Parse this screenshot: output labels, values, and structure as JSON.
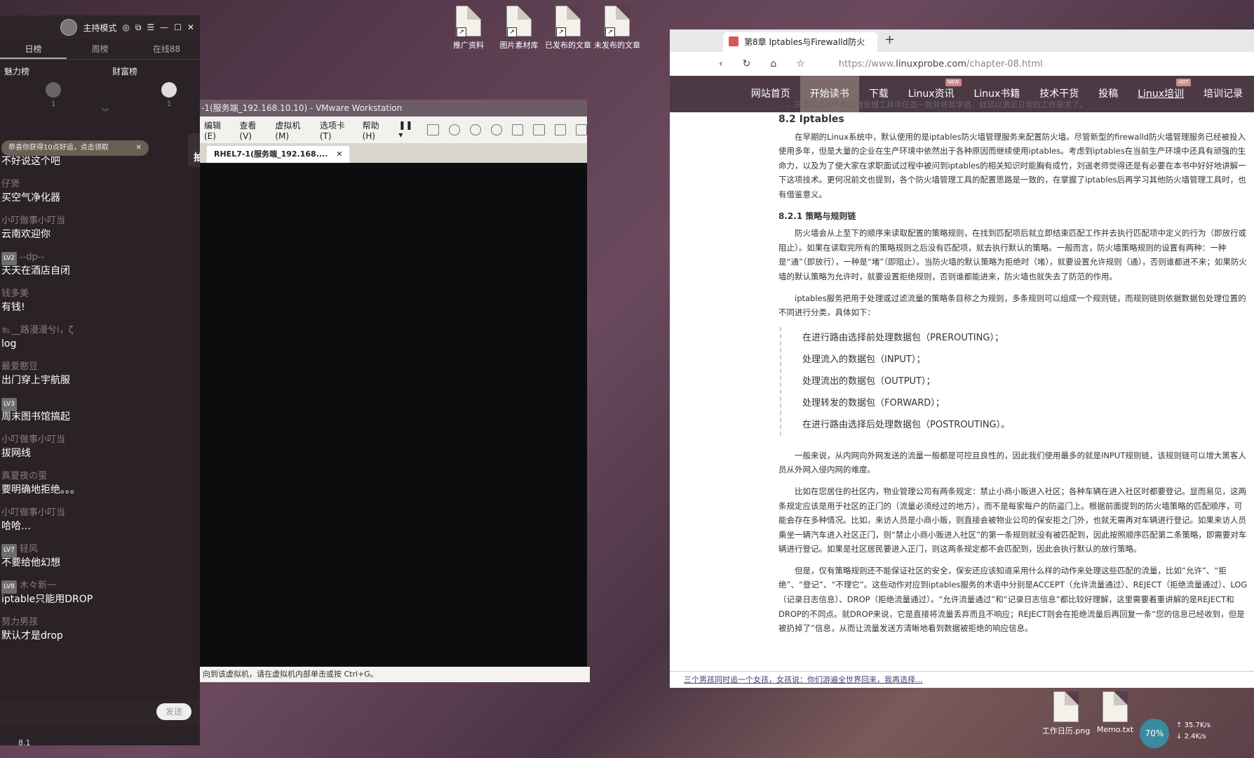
{
  "desktop": {
    "icons_top": [
      {
        "label": "推广资料"
      },
      {
        "label": "图片素材库"
      },
      {
        "label": "已发布的文章"
      },
      {
        "label": "未发布的文章"
      }
    ],
    "icons_bottom": [
      {
        "label": "工作日历.png"
      },
      {
        "label": "Memo.txt"
      }
    ],
    "clock": "8.1"
  },
  "live_panel": {
    "host_mode": "主持模式",
    "tabs": [
      "日榜",
      "周榜",
      "在线88"
    ],
    "rank_left": "魅力榜",
    "rank_right": "财富榜",
    "rank_left_count": "1",
    "rank_right_count": "1",
    "notice": "恭喜你获得10点好运，点击领取",
    "lottery": "抽奖",
    "messages": [
      {
        "user": "",
        "text": "不好说这个吧"
      },
      {
        "user": "仔煲",
        "text": "买空气净化器"
      },
      {
        "user": "小叮做事小叮当",
        "text": "云南欢迎你"
      },
      {
        "user": "--dp--",
        "level": "LV2",
        "text": "天天在酒店自闭"
      },
      {
        "user": "钱多美",
        "text": "有钱!"
      },
      {
        "user": "℡__路漫漫兮i，ζ",
        "text": "log"
      },
      {
        "user": "最爱憨豆",
        "text": "出门穿上宇航服"
      },
      {
        "user": "",
        "level": "LV3",
        "text": "周末图书馆搞起"
      },
      {
        "user": "小叮做事小叮当",
        "text": "拔网线"
      },
      {
        "user": "真夏夜の萤",
        "text": "要明确地拒绝。。。"
      },
      {
        "user": "小叮做事小叮当",
        "text": "哈哈…"
      },
      {
        "user": "轻风",
        "level": "LV7",
        "text": "不要给他幻想"
      },
      {
        "user": "木々新一",
        "level": "LV8",
        "text": "iptable只能用DROP"
      },
      {
        "user": "努力男孩",
        "text": "默认才是drop"
      }
    ],
    "send_label": "发送"
  },
  "vmware": {
    "title": "-1(服务端_192.168.10.10) - VMware Workstation",
    "menu": [
      "编辑(E)",
      "查看(V)",
      "虚拟机(M)",
      "选项卡(T)",
      "帮助(H)"
    ],
    "tab": "RHEL7-1(服务端_192.168....",
    "status": "向到该虚拟机，请在虚拟机内部单击或按 Ctrl+G。"
  },
  "browser": {
    "tab_title": "第8章 Iptables与Firewalld防火",
    "new_tab": "+",
    "url_prefix": "https://www.",
    "url_domain": "linuxprobe.com",
    "url_path": "/chapter-08.html",
    "nav": [
      {
        "label": "网站首页"
      },
      {
        "label": "开始读书",
        "active": true
      },
      {
        "label": "下载"
      },
      {
        "label": "Linux资讯",
        "badge": "NEW"
      },
      {
        "label": "Linux书籍"
      },
      {
        "label": "技术干货"
      },
      {
        "label": "投稿"
      },
      {
        "label": "Linux培训",
        "badge": "HOT"
      },
      {
        "label": "培训记录"
      }
    ],
    "cut_line": "…，只要在这多个防火墙管理工具中任选一款并将其学透，就足以满足日常的工作需求了。",
    "h2": "8.2 Iptables",
    "p1": "在早期的Linux系统中，默认使用的是iptables防火墙管理服务来配置防火墙。尽管新型的firewalld防火墙管理服务已经被投入使用多年，但是大量的企业在生产环境中依然出于各种原因而继续使用iptables。考虑到iptables在当前生产环境中还具有顽强的生命力，以及为了使大家在求职面试过程中被问到iptables的相关知识时能胸有成竹，刘遄老师觉得还是有必要在本书中好好地讲解一下这项技术。更何况前文也提到，各个防火墙管理工具的配置思路是一致的，在掌握了iptables后再学习其他防火墙管理工具时，也有借鉴意义。",
    "h3": "8.2.1 策略与规则链",
    "p2": "防火墙会从上至下的顺序来读取配置的策略规则，在找到匹配项后就立即结束匹配工作并去执行匹配项中定义的行为（即放行或阻止）。如果在读取完所有的策略规则之后没有匹配项，就去执行默认的策略。一般而言，防火墙策略规则的设置有两种：一种是“通”（即放行），一种是“堵”（即阻止）。当防火墙的默认策略为拒绝时（堵），就要设置允许规则（通），否则谁都进不来；如果防火墙的默认策略为允许时，就要设置拒绝规则，否则谁都能进来，防火墙也就失去了防范的作用。",
    "p3": "iptables服务把用于处理或过滤流量的策略条目称之为规则，多条规则可以组成一个规则链，而规则链则依据数据包处理位置的不同进行分类，具体如下：",
    "chains": [
      "在进行路由选择前处理数据包（PREROUTING）；",
      "处理流入的数据包（INPUT）；",
      "处理流出的数据包（OUTPUT）；",
      "处理转发的数据包（FORWARD）；",
      "在进行路由选择后处理数据包（POSTROUTING）。"
    ],
    "p4": "一般来说，从内网向外网发送的流量一般都是可控且良性的，因此我们使用最多的就是INPUT规则链，该规则链可以增大黑客人员从外网入侵内网的难度。",
    "p5": "比如在您居住的社区内，物业管理公司有两条规定：禁止小商小贩进入社区；各种车辆在进入社区时都要登记。显而易见，这两条规定应该是用于社区的正门的（流量必须经过的地方），而不是每家每户的防盗门上。根据前面提到的防火墙策略的匹配顺序，可能会存在多种情况。比如，来访人员是小商小贩，则直接会被物业公司的保安拒之门外，也就无需再对车辆进行登记。如果来访人员乘坐一辆汽车进入社区正门，则“禁止小商小贩进入社区”的第一条规则就没有被匹配到，因此按照顺序匹配第二条策略，即需要对车辆进行登记。如果是社区居民要进入正门，则这两条规定都不会匹配到，因此会执行默认的放行策略。",
    "p6": "但是，仅有策略规则还不能保证社区的安全，保安还应该知道采用什么样的动作来处理这些匹配的流量，比如“允许”、“拒绝”、“登记”、“不理它”。这些动作对应到iptables服务的术语中分别是ACCEPT（允许流量通过）、REJECT（拒绝流量通过）、LOG（记录日志信息）、DROP（拒绝流量通过）。“允许流量通过”和“记录日志信息”都比较好理解，这里需要着重讲解的是REJECT和DROP的不同点。就DROP来说，它是直接将流量丢弃而且不响应；REJECT则会在拒绝流量后再回复一条“您的信息已经收到，但是被扔掉了”信息，从而让流量发送方清晰地看到数据被拒绝的响应信息。",
    "footer": "三个男孩同时追一个女孩，女孩说：你们游遍全世界回来，我再选择..."
  },
  "net": {
    "percent": "70%",
    "up": "35.7K/s",
    "down": "2.4K/s"
  }
}
